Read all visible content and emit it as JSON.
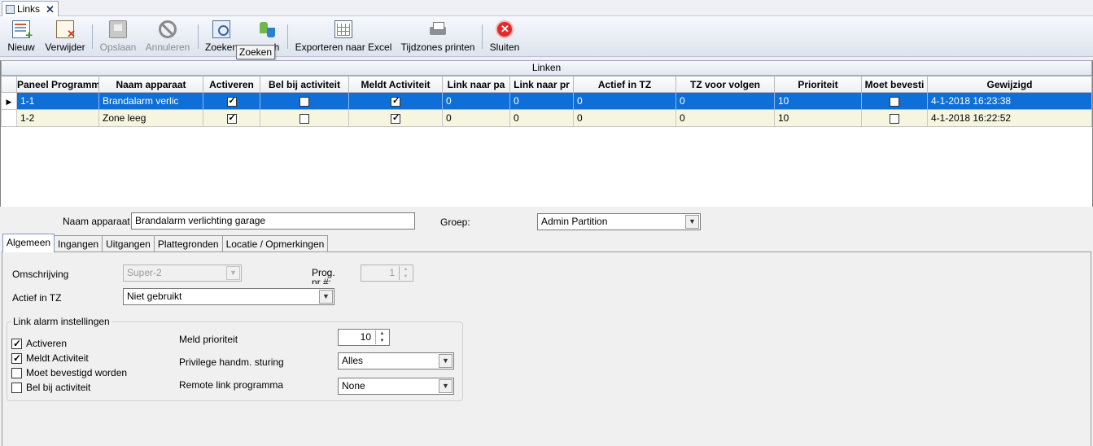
{
  "doc_tab": {
    "label": "Links",
    "close": "✕"
  },
  "toolbar": {
    "new_label": "Nieuw",
    "delete_label": "Verwijder",
    "save_label": "Opslaan",
    "cancel_label": "Annuleren",
    "search_label": "Zoeken",
    "refresh_label_fragment": "h",
    "export_label": "Exporteren naar Excel",
    "timezones_print_label": "Tijdzones printen",
    "close_label": "Sluiten"
  },
  "tooltip": {
    "text": "Zoeken"
  },
  "grid": {
    "caption": "Linken",
    "columns": [
      "Paneel Programma",
      "Naam apparaat",
      "Activeren",
      "Bel bij activiteit",
      "Meldt Activiteit",
      "Link naar pa",
      "Link naar pr",
      "Actief in TZ",
      "TZ voor volgen",
      "Prioriteit",
      "Moet bevesti",
      "Gewijzigd"
    ],
    "rows": [
      {
        "programma": "1-1",
        "naam": "Brandalarm verlic",
        "activeren": true,
        "bel": false,
        "meldt": true,
        "link_pa": "0",
        "link_pr": "0",
        "actief_tz": "0",
        "tz_volgen": "0",
        "prioriteit": "10",
        "moet": false,
        "gewijzigd": "4-1-2018 16:23:38",
        "selected": true
      },
      {
        "programma": "1-2",
        "naam": "Zone leeg",
        "activeren": true,
        "bel": false,
        "meldt": true,
        "link_pa": "0",
        "link_pr": "0",
        "actief_tz": "0",
        "tz_volgen": "0",
        "prioriteit": "10",
        "moet": false,
        "gewijzigd": "4-1-2018 16:22:52",
        "selected": false
      }
    ]
  },
  "detail": {
    "naam_label": "Naam apparaat",
    "naam_value": "Brandalarm verlichting garage",
    "groep_label": "Groep:",
    "groep_value": "Admin Partition"
  },
  "tabs": [
    "Algemeen",
    "Ingangen",
    "Uitgangen",
    "Plattegronden",
    "Locatie / Opmerkingen"
  ],
  "algemeen": {
    "omschrijving_label": "Omschrijving",
    "omschrijving_value": "Super-2",
    "prog_label": "Prog. nr #:",
    "prog_value": "1",
    "actief_tz_label": "Actief in TZ",
    "actief_tz_value": "Niet gebruikt",
    "group_title": "Link alarm instellingen",
    "checkboxes": [
      {
        "label": "Activeren",
        "checked": true
      },
      {
        "label": "Meldt Activiteit",
        "checked": true
      },
      {
        "label": "Moet bevestigd worden",
        "checked": false
      },
      {
        "label": "Bel bij activiteit",
        "checked": false
      }
    ],
    "meld_prioriteit_label": "Meld prioriteit",
    "meld_prioriteit_value": "10",
    "privilege_label": "Privilege handm. sturing",
    "privilege_value": "Alles",
    "remote_label": "Remote link programma",
    "remote_value": "None"
  }
}
